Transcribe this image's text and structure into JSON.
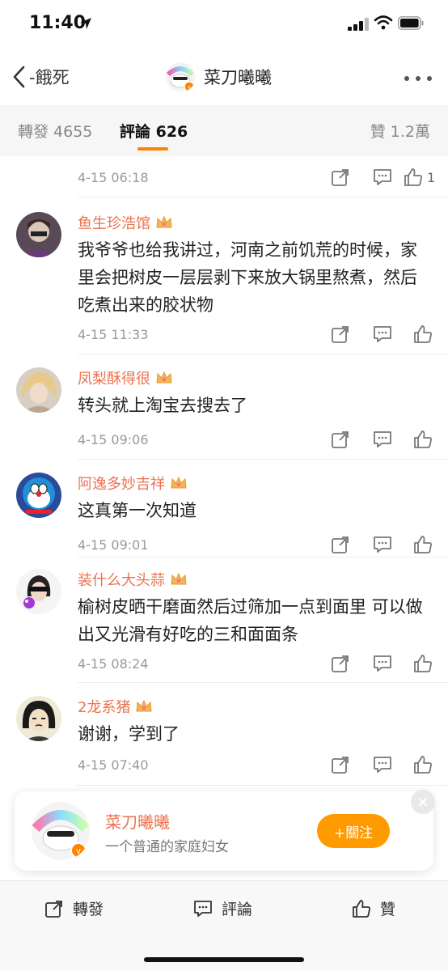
{
  "status_bar": {
    "time": "11:40"
  },
  "nav": {
    "back_label": "-餓死",
    "title": "菜刀曦曦"
  },
  "tabs": {
    "repost": "轉發 4655",
    "comments": "評論 626",
    "likes": "贊 1.2萬"
  },
  "partial_comment": {
    "time": "4-15 06:18",
    "likes": "1"
  },
  "comments": [
    {
      "name": "鱼生珍浩馆",
      "text": "我爷爷也给我讲过，河南之前饥荒的时候，家里会把树皮一层层剥下来放大锅里熬煮，然后吃煮出来的胶状物",
      "time": "4-15 11:33"
    },
    {
      "name": "凤梨酥得很",
      "text": "转头就上淘宝去搜去了",
      "time": "4-15 09:06"
    },
    {
      "name": "阿逸多妙吉祥",
      "text": "这真第一次知道",
      "time": "4-15 09:01"
    },
    {
      "name": "装什么大头蒜",
      "text": "榆树皮晒干磨面然后过筛加一点到面里 可以做出又光滑有好吃的三和面面条",
      "time": "4-15 08:24"
    },
    {
      "name": "2龙系猪",
      "text": "谢谢，学到了",
      "time": "4-15 07:40"
    }
  ],
  "follow_card": {
    "name": "菜刀曦曦",
    "description": "一个普通的家庭妇女",
    "button": "+關注"
  },
  "bottom_bar": {
    "share": "轉發",
    "comment": "評論",
    "like": "贊"
  },
  "colors": {
    "accent": "#ff8200",
    "username": "#eb7350",
    "follow_button": "#ff9a00"
  }
}
